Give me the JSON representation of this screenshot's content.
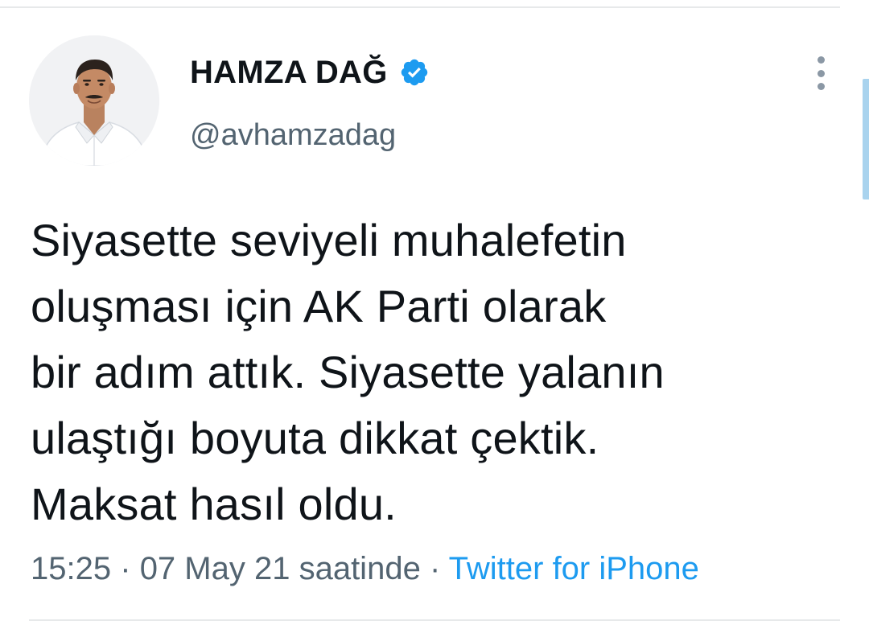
{
  "author": {
    "display_name": "HAMZA DAĞ",
    "handle": "@avhamzadag",
    "verified": true
  },
  "tweet": {
    "lines": [
      "Siyasette seviyeli muhalefetin",
      "oluşması için AK Parti olarak",
      "bir adım attık. Siyasette yalanın",
      "ulaştığı boyuta dikkat çektik.",
      "Maksat hasıl oldu."
    ]
  },
  "meta": {
    "time": "15:25",
    "separator": "·",
    "date": "07 May 21 saatinde",
    "source": "Twitter for iPhone"
  },
  "icons": {
    "verified": "verified-badge-icon",
    "more": "more-vertical-icon",
    "avatar": "profile-photo"
  },
  "colors": {
    "text_primary": "#0f1419",
    "text_secondary": "#536471",
    "link": "#1d9bf0",
    "verified": "#1d9bf0"
  }
}
